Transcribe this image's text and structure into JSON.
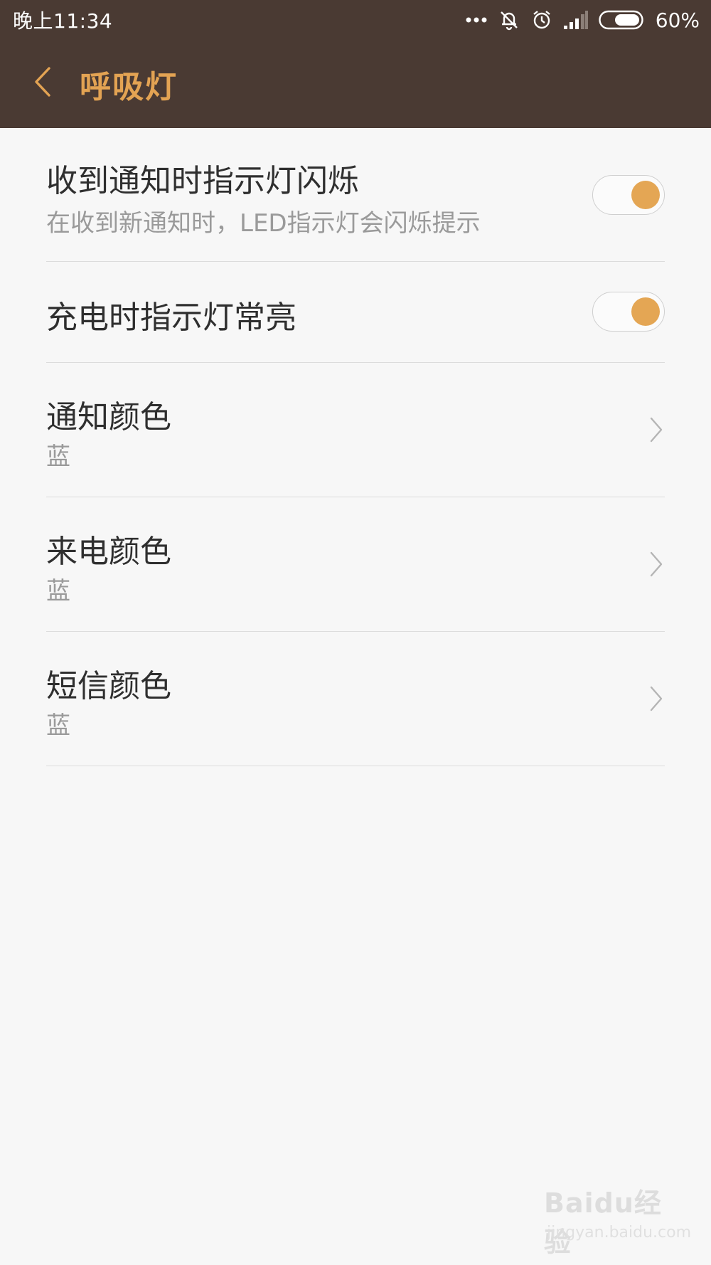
{
  "status_bar": {
    "time": "晚上11:34",
    "battery_percent": "60%",
    "battery_level": 0.6,
    "icons": [
      "more-dots-icon",
      "notifications-muted-icon",
      "alarm-icon",
      "signal-icon",
      "battery-icon"
    ]
  },
  "header": {
    "title": "呼吸灯",
    "back_icon": "chevron-left-icon",
    "title_color": "#e3a353",
    "background_color": "#4a3a33"
  },
  "settings": {
    "notification_blink": {
      "title": "收到通知时指示灯闪烁",
      "subtitle": "在收到新通知时，LED指示灯会闪烁提示",
      "enabled": true
    },
    "charging_light": {
      "title": "充电时指示灯常亮",
      "enabled": true
    },
    "notification_color": {
      "title": "通知颜色",
      "value": "蓝"
    },
    "call_color": {
      "title": "来电颜色",
      "value": "蓝"
    },
    "sms_color": {
      "title": "短信颜色",
      "value": "蓝"
    }
  },
  "accent_color": "#e4a654",
  "watermark": {
    "logo": "Baidu经验",
    "url": "jingyan.baidu.com"
  }
}
